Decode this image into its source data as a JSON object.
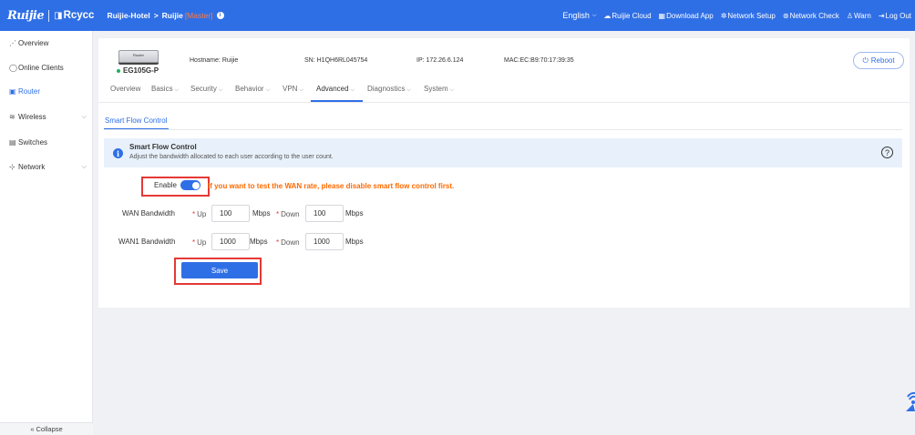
{
  "header": {
    "logo_left": "Ruijie",
    "logo_right": "Rcycc",
    "breadcrumb_root": "Ruijie-Hotel",
    "breadcrumb_arrow": ">",
    "breadcrumb_device": "Ruijie",
    "breadcrumb_role": "[Master]",
    "language": "English",
    "links": [
      {
        "icon": "cloud-icon",
        "label": "Ruijie Cloud"
      },
      {
        "icon": "qr-code-icon",
        "label": "Download App"
      },
      {
        "icon": "network-setup-icon",
        "label": "Network Setup"
      },
      {
        "icon": "network-check-icon",
        "label": "Network Check"
      },
      {
        "icon": "warn-icon",
        "label": "Warn"
      },
      {
        "icon": "logout-icon",
        "label": "Log Out"
      }
    ]
  },
  "sidebar": {
    "items": [
      {
        "icon": "overview-icon",
        "label": "Overview"
      },
      {
        "icon": "online-clients-icon",
        "label": "Online Clients"
      },
      {
        "icon": "router-icon",
        "label": "Router"
      },
      {
        "icon": "wireless-icon",
        "label": "Wireless"
      },
      {
        "icon": "switches-icon",
        "label": "Switches"
      },
      {
        "icon": "network-icon",
        "label": "Network"
      }
    ],
    "collapse_label": "Collapse"
  },
  "device": {
    "image_label": "Router",
    "model": "EG105G-P",
    "status_color": "#1fb15a",
    "hostname_label": "Hostname:",
    "hostname": "Ruijie",
    "sn_label": "SN:",
    "sn": "H1QH6RL045754",
    "ip_label": "IP:",
    "ip": "172.26.6.124",
    "mac_label": "MAC:",
    "mac": "EC:B9:70:17:39:35",
    "reboot_label": "Reboot"
  },
  "tabs": [
    {
      "label": "Overview",
      "dropdown": false
    },
    {
      "label": "Basics",
      "dropdown": true
    },
    {
      "label": "Security",
      "dropdown": true
    },
    {
      "label": "Behavior",
      "dropdown": true
    },
    {
      "label": "VPN",
      "dropdown": true
    },
    {
      "label": "Advanced",
      "dropdown": true
    },
    {
      "label": "Diagnostics",
      "dropdown": true
    },
    {
      "label": "System",
      "dropdown": true
    }
  ],
  "active_tab": "Advanced",
  "subtab": "Smart Flow Control",
  "banner": {
    "title": "Smart Flow Control",
    "description": "Adjust the bandwidth allocated to each user according to the user count."
  },
  "form": {
    "enable_label": "Enable",
    "enabled": true,
    "warning": "If you want to test the WAN rate, please disable smart flow control first.",
    "rows": [
      {
        "label": "WAN Bandwidth",
        "up_label": "Up",
        "up_value": "100",
        "down_label": "Down",
        "down_value": "100",
        "unit": "Mbps"
      },
      {
        "label": "WAN1 Bandwidth",
        "up_label": "Up",
        "up_value": "1000",
        "down_label": "Down",
        "down_value": "1000",
        "unit": "Mbps"
      }
    ],
    "save_label": "Save"
  },
  "colors": {
    "brand": "#2f6fe6",
    "warning": "#ff6a00",
    "highlight": "#e53935"
  }
}
